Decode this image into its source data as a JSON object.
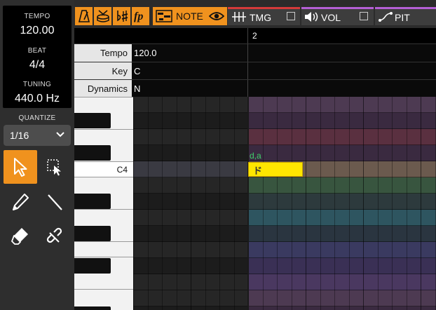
{
  "info": {
    "tempo_label": "TEMPO",
    "tempo_value": "120.00",
    "beat_label": "BEAT",
    "beat_value": "4/4",
    "tuning_label": "TUNING",
    "tuning_value": "440.0 Hz"
  },
  "quantize": {
    "label": "QUANTIZE",
    "value": "1/16"
  },
  "tools": [
    "select-arrow-icon",
    "range-select-icon",
    "pencil-icon",
    "line-icon",
    "eraser-icon",
    "link-icon"
  ],
  "toolbar": {
    "note_label": "NOTE",
    "tabs": [
      {
        "label": "TMG",
        "color": "#d43a3a"
      },
      {
        "label": "VOL",
        "color": "#b45fd6"
      },
      {
        "label": "PIT",
        "color": "#b45fd6"
      }
    ]
  },
  "ruler": {
    "bar_number": "2"
  },
  "params": [
    {
      "label": "Tempo",
      "value": "120.0"
    },
    {
      "label": "Key",
      "value": "C"
    },
    {
      "label": "Dynamics",
      "value": "N"
    }
  ],
  "roll": {
    "c4_label": "C4",
    "note": {
      "lyric": "ド",
      "phoneme": "d,a",
      "color": "#ffe600"
    }
  }
}
